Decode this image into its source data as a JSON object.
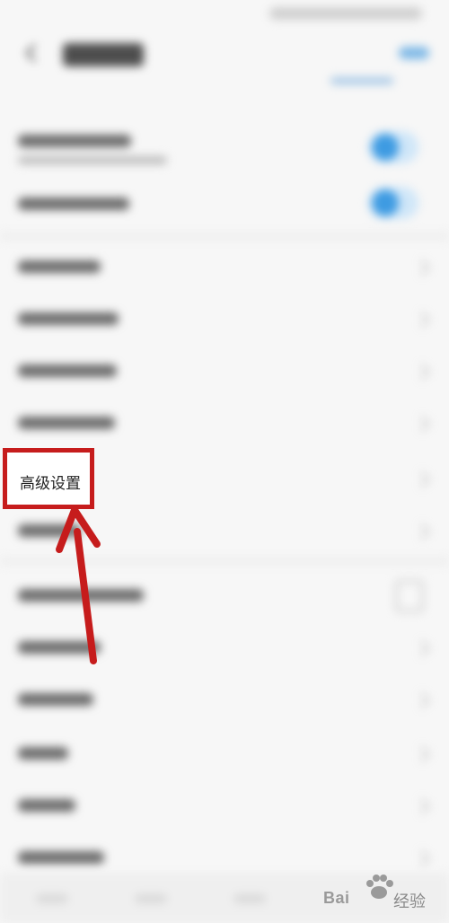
{
  "highlight": {
    "label": "高级设置",
    "color": "#c61c1c"
  },
  "watermark": {
    "brand": "Bai",
    "du_text": "du",
    "suffix": "经验"
  },
  "colors": {
    "toggle_on": "#3e9be2",
    "accent": "#7fb9e6"
  },
  "icons": {
    "back": "back-arrow-icon",
    "chevron": "chevron-right-icon",
    "toggle": "toggle-switch-icon",
    "pointer": "red-arrow-pointer",
    "paw": "baidu-paw-icon"
  }
}
